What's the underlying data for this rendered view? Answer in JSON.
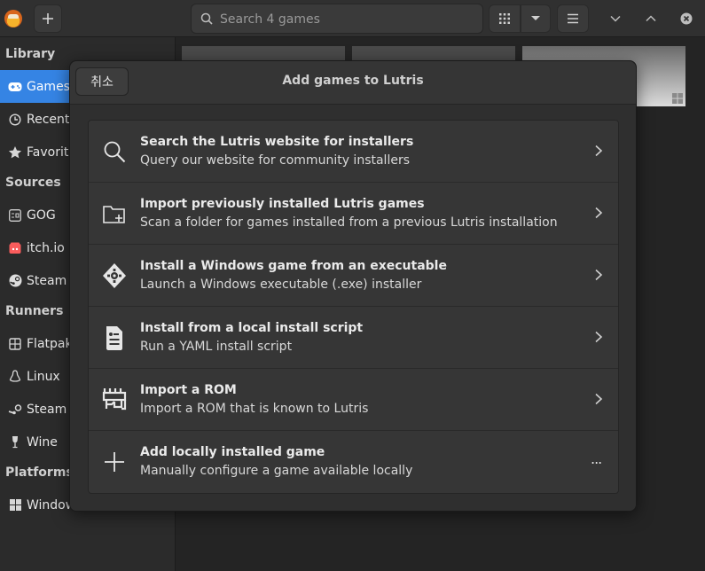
{
  "header": {
    "search_placeholder": "Search 4 games"
  },
  "sidebar": {
    "sections": [
      {
        "title": "Library"
      },
      {
        "title": "Sources"
      },
      {
        "title": "Runners"
      },
      {
        "title": "Platforms"
      }
    ],
    "library": [
      {
        "label": "Games",
        "icon": "gamepad-icon"
      },
      {
        "label": "Recent",
        "icon": "clock-icon"
      },
      {
        "label": "Favorites",
        "icon": "star-icon"
      }
    ],
    "sources": [
      {
        "label": "GOG",
        "icon": "gog-icon"
      },
      {
        "label": "itch.io",
        "icon": "itchio-icon"
      },
      {
        "label": "Steam",
        "icon": "steam-icon"
      }
    ],
    "runners": [
      {
        "label": "Flatpak",
        "icon": "flatpak-icon"
      },
      {
        "label": "Linux",
        "icon": "linux-icon"
      },
      {
        "label": "Steam",
        "icon": "steam-runner-icon"
      },
      {
        "label": "Wine",
        "icon": "wine-icon"
      }
    ],
    "platforms": [
      {
        "label": "Windows",
        "icon": "windows-icon"
      }
    ]
  },
  "dialog": {
    "cancel_label": "취소",
    "title": "Add games to Lutris",
    "options": [
      {
        "title": "Search the Lutris website for installers",
        "subtitle": "Query our website for community installers",
        "icon": "search-icon",
        "action": "chevron-right-icon"
      },
      {
        "title": "Import previously installed Lutris games",
        "subtitle": "Scan a folder for games installed from a previous Lutris installation",
        "icon": "folder-add-icon",
        "action": "chevron-right-icon"
      },
      {
        "title": "Install a Windows game from an executable",
        "subtitle": "Launch a Windows executable (.exe) installer",
        "icon": "executable-icon",
        "action": "chevron-right-icon"
      },
      {
        "title": "Install from a local install script",
        "subtitle": "Run a YAML install script",
        "icon": "script-icon",
        "action": "chevron-right-icon"
      },
      {
        "title": "Import a ROM",
        "subtitle": "Import a ROM that is known to Lutris",
        "icon": "rom-icon",
        "action": "chevron-right-icon"
      },
      {
        "title": "Add locally installed game",
        "subtitle": "Manually configure a game available locally",
        "icon": "plus-icon",
        "action": "more-icon",
        "action_text": "..."
      }
    ]
  },
  "colors": {
    "accent": "#3584e4",
    "window_bg": "#242424",
    "dialog_bg": "#2f2f2f"
  }
}
